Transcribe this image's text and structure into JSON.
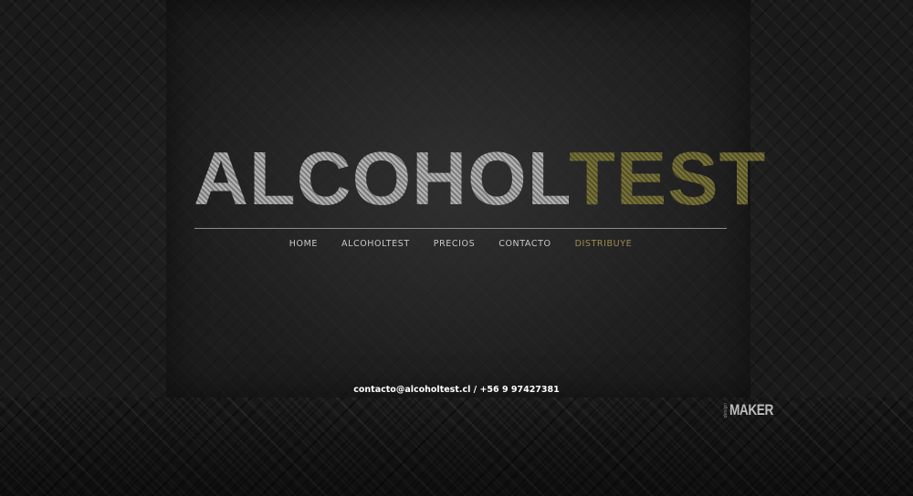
{
  "brand": {
    "logo_part_a": "ALCOHOL",
    "logo_part_b": "TEST",
    "colors": {
      "logo_gray": "#9a9a9a",
      "logo_olive": "#6b6633",
      "nav_text": "#c9c9c9",
      "nav_active": "#a18a52",
      "background": "#1a1a1a"
    }
  },
  "nav": {
    "items": [
      {
        "label": "HOME"
      },
      {
        "label": "ALCOHOLTEST"
      },
      {
        "label": "PRECIOS"
      },
      {
        "label": "CONTACTO"
      },
      {
        "label": "DISTRIBUYE",
        "active": true
      }
    ]
  },
  "footer": {
    "contact": "contacto@alcoholtest.cl / +56 9 97427381",
    "credit_small": "design",
    "credit_big": "MAKER"
  }
}
